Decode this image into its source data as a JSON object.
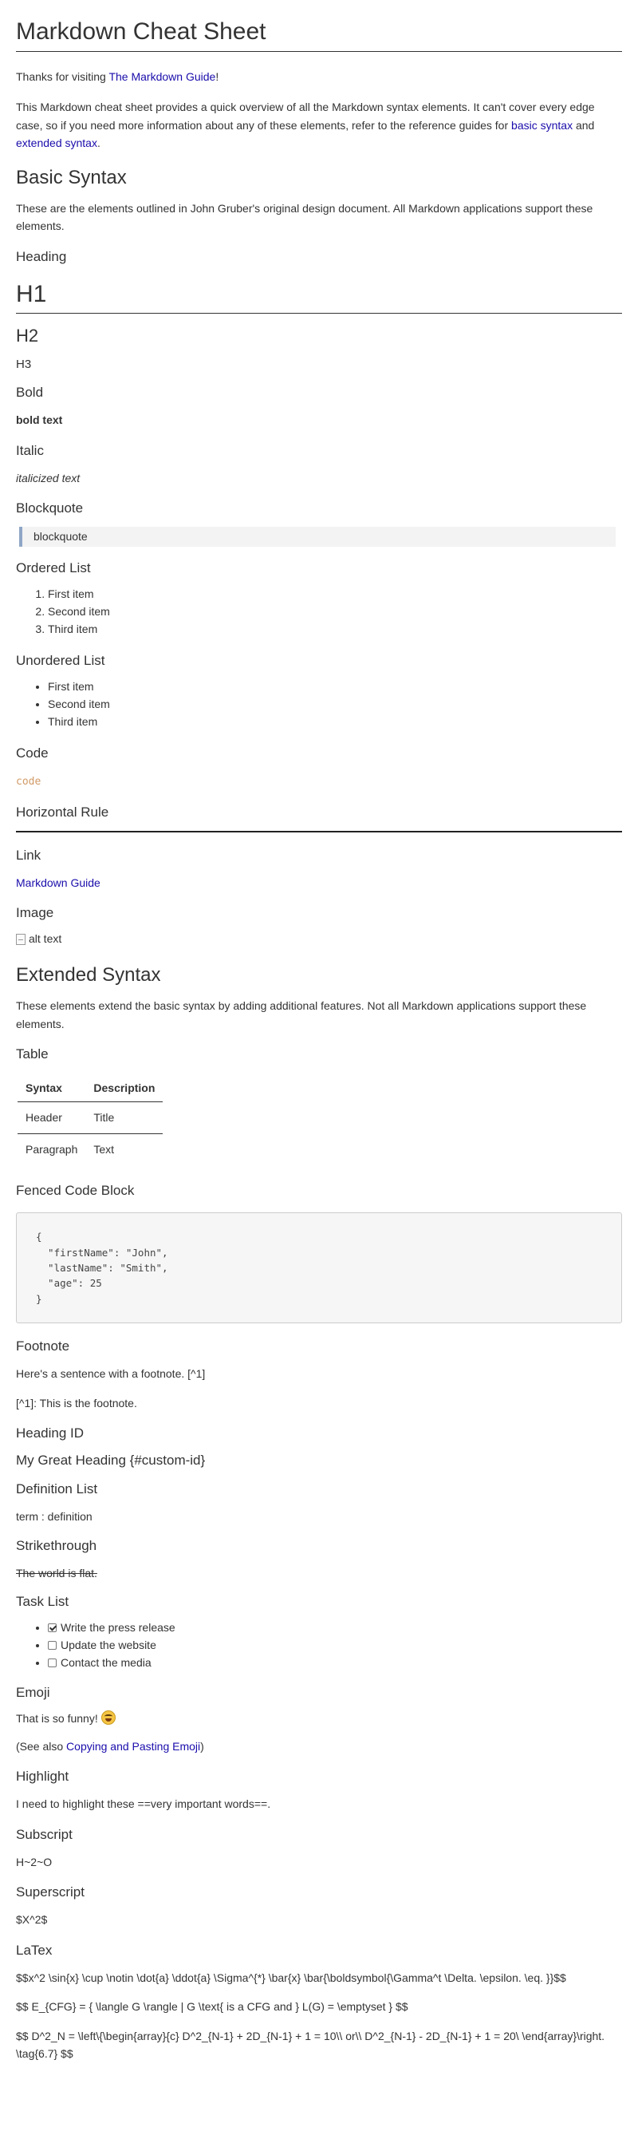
{
  "title": "Markdown Cheat Sheet",
  "intro": {
    "thanks_prefix": "Thanks for visiting ",
    "thanks_link": "The Markdown Guide",
    "thanks_suffix": "!",
    "desc_prefix": "This Markdown cheat sheet provides a quick overview of all the Markdown syntax elements. It can't cover every edge case, so if you need more information about any of these elements, refer to the reference guides for ",
    "desc_link1": "basic syntax",
    "desc_mid": " and ",
    "desc_link2": "extended syntax",
    "desc_suffix": "."
  },
  "basic": {
    "heading": "Basic Syntax",
    "desc": "These are the elements outlined in John Gruber's original design document. All Markdown applications support these elements.",
    "heading_label": "Heading",
    "h1": "H1",
    "h2": "H2",
    "h3": "H3",
    "bold_label": "Bold",
    "bold_text": "bold text",
    "italic_label": "Italic",
    "italic_text": "italicized text",
    "blockquote_label": "Blockquote",
    "blockquote_text": "blockquote",
    "ordered_label": "Ordered List",
    "ordered_items": [
      "First item",
      "Second item",
      "Third item"
    ],
    "unordered_label": "Unordered List",
    "unordered_items": [
      "First item",
      "Second item",
      "Third item"
    ],
    "code_label": "Code",
    "code_text": "code",
    "hr_label": "Horizontal Rule",
    "link_label": "Link",
    "link_text": "Markdown Guide",
    "image_label": "Image",
    "image_alt": "alt text"
  },
  "extended": {
    "heading": "Extended Syntax",
    "desc": "These elements extend the basic syntax by adding additional features. Not all Markdown applications support these elements.",
    "table_label": "Table",
    "table": {
      "headers": [
        "Syntax",
        "Description"
      ],
      "rows": [
        [
          "Header",
          "Title"
        ],
        [
          "Paragraph",
          "Text"
        ]
      ]
    },
    "fenced_label": "Fenced Code Block",
    "fenced_code": "{\n  \"firstName\": \"John\",\n  \"lastName\": \"Smith\",\n  \"age\": 25\n}",
    "footnote_label": "Footnote",
    "footnote_sentence": "Here's a sentence with a footnote. [^1]",
    "footnote_def": "[^1]: This is the footnote.",
    "heading_id_label": "Heading ID",
    "heading_id_text": "My Great Heading {#custom-id}",
    "deflist_label": "Definition List",
    "deflist_text": "term : definition",
    "strike_label": "Strikethrough",
    "strike_text": "The world is flat.",
    "tasklist_label": "Task List",
    "tasks": [
      {
        "label": "Write the press release",
        "checked": true
      },
      {
        "label": "Update the website",
        "checked": false
      },
      {
        "label": "Contact the media",
        "checked": false
      }
    ],
    "emoji_label": "Emoji",
    "emoji_text": "That is so funny!",
    "emoji_icon": "laughing-emoji-icon",
    "emoji_see_prefix": "(See also ",
    "emoji_see_link": "Copying and Pasting Emoji",
    "emoji_see_suffix": ")",
    "highlight_label": "Highlight",
    "highlight_text": "I need to highlight these ==very important words==.",
    "subscript_label": "Subscript",
    "subscript_text": "H~2~O",
    "superscript_label": "Superscript",
    "superscript_text": "$X^2$",
    "latex_label": "LaTex",
    "latex_lines": [
      "$$x^2 \\sin{x} \\cup \\notin \\dot{a} \\ddot{a} \\Sigma^{*} \\bar{x} \\bar{\\boldsymbol{\\Gamma^t \\Delta. \\epsilon. \\eq. }}$$",
      "$$ E_{CFG} = { \\langle G \\rangle | G \\text{ is a CFG and } L(G) = \\emptyset } $$",
      "$$ D^2_N = \\left\\{\\begin{array}{c} D^2_{N-1} + 2D_{N-1} + 1 = 10\\\\ or\\\\ D^2_{N-1} - 2D_{N-1} + 1 = 20\\ \\end{array}\\right. \\tag{6.7} $$"
    ]
  },
  "colors": {
    "link": "#1a0dab",
    "code": "#d19a66",
    "blockquote_bar": "#8fa7c6",
    "blockquote_bg": "#f3f3f3"
  }
}
